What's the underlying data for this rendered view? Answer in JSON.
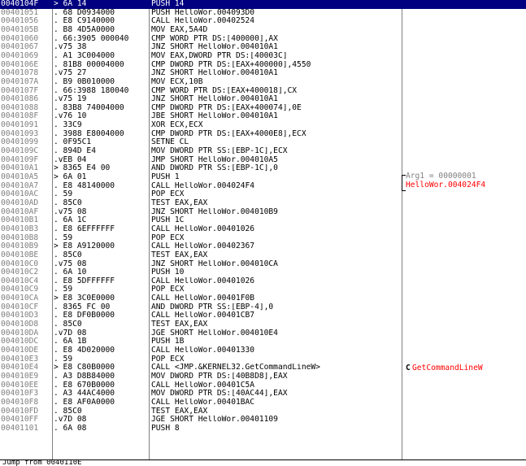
{
  "rows": [
    {
      "addr": "0040104F",
      "hex": "> 6A 14",
      "asm": "PUSH 14",
      "selected": true
    },
    {
      "addr": "00401051",
      "hex": ". 68 D0934000",
      "asm": "PUSH HelloWor.004093D0"
    },
    {
      "addr": "00401056",
      "hex": ". E8 C9140000",
      "asm": "CALL HelloWor.00402524"
    },
    {
      "addr": "0040105B",
      "hex": ". B8 4D5A0000",
      "asm": "MOV EAX,5A4D"
    },
    {
      "addr": "00401060",
      "hex": ". 66:3905 000040",
      "asm": "CMP WORD PTR DS:[400000],AX"
    },
    {
      "addr": "00401067",
      "hex": ".v75 38",
      "asm": "JNZ SHORT HelloWor.004010A1"
    },
    {
      "addr": "00401069",
      "hex": ". A1 3C004000",
      "asm": "MOV EAX,DWORD PTR DS:[40003C]"
    },
    {
      "addr": "0040106E",
      "hex": ". 81B8 00004000",
      "asm": "CMP DWORD PTR DS:[EAX+400000],4550"
    },
    {
      "addr": "00401078",
      "hex": ".v75 27",
      "asm": "JNZ SHORT HelloWor.004010A1"
    },
    {
      "addr": "0040107A",
      "hex": ". B9 0B010000",
      "asm": "MOV ECX,10B"
    },
    {
      "addr": "0040107F",
      "hex": ". 66:3988 180040",
      "asm": "CMP WORD PTR DS:[EAX+400018],CX"
    },
    {
      "addr": "00401086",
      "hex": ".v75 19",
      "asm": "JNZ SHORT HelloWor.004010A1"
    },
    {
      "addr": "00401088",
      "hex": ". 83B8 74004000",
      "asm": "CMP DWORD PTR DS:[EAX+400074],0E"
    },
    {
      "addr": "0040108F",
      "hex": ".v76 10",
      "asm": "JBE SHORT HelloWor.004010A1"
    },
    {
      "addr": "00401091",
      "hex": ". 33C9",
      "asm": "XOR ECX,ECX"
    },
    {
      "addr": "00401093",
      "hex": ". 3988 E8004000",
      "asm": "CMP DWORD PTR DS:[EAX+4000E8],ECX"
    },
    {
      "addr": "00401099",
      "hex": ". 0F95C1",
      "asm": "SETNE CL"
    },
    {
      "addr": "0040109C",
      "hex": ". 894D E4",
      "asm": "MOV DWORD PTR SS:[EBP-1C],ECX"
    },
    {
      "addr": "0040109F",
      "hex": ".vEB 04",
      "asm": "JMP SHORT HelloWor.004010A5"
    },
    {
      "addr": "004010A1",
      "hex": "> 8365 E4 00",
      "asm": "AND DWORD PTR SS:[EBP-1C],0"
    },
    {
      "addr": "004010A5",
      "hex": "> 6A 01",
      "asm": "PUSH 1"
    },
    {
      "addr": "004010A7",
      "hex": ". E8 48140000",
      "asm": "CALL HelloWor.004024F4"
    },
    {
      "addr": "004010AC",
      "hex": ". 59",
      "asm": "POP ECX"
    },
    {
      "addr": "004010AD",
      "hex": ". 85C0",
      "asm": "TEST EAX,EAX"
    },
    {
      "addr": "004010AF",
      "hex": ".v75 08",
      "asm": "JNZ SHORT HelloWor.004010B9"
    },
    {
      "addr": "004010B1",
      "hex": ". 6A 1C",
      "asm": "PUSH 1C"
    },
    {
      "addr": "004010B3",
      "hex": ". E8 6EFFFFFF",
      "asm": "CALL HelloWor.00401026"
    },
    {
      "addr": "004010B8",
      "hex": ". 59",
      "asm": "POP ECX"
    },
    {
      "addr": "004010B9",
      "hex": "> E8 A9120000",
      "asm": "CALL HelloWor.00402367"
    },
    {
      "addr": "004010BE",
      "hex": ". 85C0",
      "asm": "TEST EAX,EAX"
    },
    {
      "addr": "004010C0",
      "hex": ".v75 08",
      "asm": "JNZ SHORT HelloWor.004010CA"
    },
    {
      "addr": "004010C2",
      "hex": ". 6A 10",
      "asm": "PUSH 10"
    },
    {
      "addr": "004010C4",
      "hex": ". E8 5DFFFFFF",
      "asm": "CALL HelloWor.00401026"
    },
    {
      "addr": "004010C9",
      "hex": ". 59",
      "asm": "POP ECX"
    },
    {
      "addr": "004010CA",
      "hex": "> E8 3C0E0000",
      "asm": "CALL HelloWor.00401F0B"
    },
    {
      "addr": "004010CF",
      "hex": ". 8365 FC 00",
      "asm": "AND DWORD PTR SS:[EBP-4],0"
    },
    {
      "addr": "004010D3",
      "hex": ". E8 DF0B0000",
      "asm": "CALL HelloWor.00401CB7"
    },
    {
      "addr": "004010D8",
      "hex": ". 85C0",
      "asm": "TEST EAX,EAX"
    },
    {
      "addr": "004010DA",
      "hex": ".v7D 08",
      "asm": "JGE SHORT HelloWor.004010E4"
    },
    {
      "addr": "004010DC",
      "hex": ". 6A 1B",
      "asm": "PUSH 1B"
    },
    {
      "addr": "004010DE",
      "hex": ". E8 4D020000",
      "asm": "CALL HelloWor.00401330"
    },
    {
      "addr": "004010E3",
      "hex": ". 59",
      "asm": "POP ECX"
    },
    {
      "addr": "004010E4",
      "hex": "> E8 C80B0000",
      "asm": "CALL <JMP.&KERNEL32.GetCommandLineW>"
    },
    {
      "addr": "004010E9",
      "hex": ". A3 D8B84000",
      "asm": "MOV DWORD PTR DS:[40B8D8],EAX"
    },
    {
      "addr": "004010EE",
      "hex": ". E8 670B0000",
      "asm": "CALL HelloWor.00401C5A"
    },
    {
      "addr": "004010F3",
      "hex": ". A3 44AC4000",
      "asm": "MOV DWORD PTR DS:[40AC44],EAX"
    },
    {
      "addr": "004010F8",
      "hex": ". E8 AF0A0000",
      "asm": "CALL HelloWor.00401BAC"
    },
    {
      "addr": "004010FD",
      "hex": ". 85C0",
      "asm": "TEST EAX,EAX"
    },
    {
      "addr": "004010FF",
      "hex": ".v7D 08",
      "asm": "JGE SHORT HelloWor.00401109"
    },
    {
      "addr": "00401101",
      "hex": ". 6A 08",
      "asm": "PUSH 8"
    }
  ],
  "comments": {
    "arg1": "Arg1 = 00000001",
    "call_target": "HelloWor.004024F4",
    "getcmdline": "GetCommandLineW"
  },
  "info_bar": "Jump from 0040110E",
  "colors": {
    "selection": "#000080",
    "address_text": "#808080",
    "comment_arg": "#808080",
    "comment_call": "#ff0000"
  }
}
